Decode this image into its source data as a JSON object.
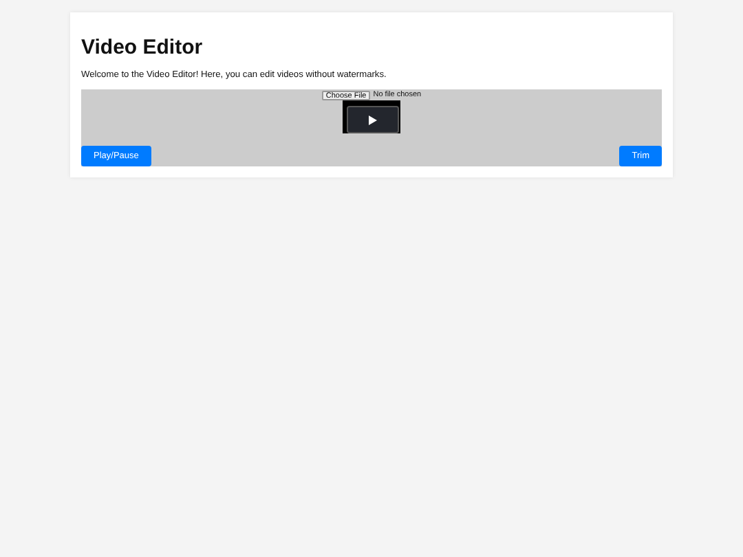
{
  "title": "Video Editor",
  "intro": "Welcome to the Video Editor! Here, you can edit videos without watermarks.",
  "file_input": {
    "button": "Choose File",
    "status": "No file chosen"
  },
  "controls": [
    {
      "label": "Play/Pause"
    },
    {
      "label": "Trim"
    }
  ]
}
